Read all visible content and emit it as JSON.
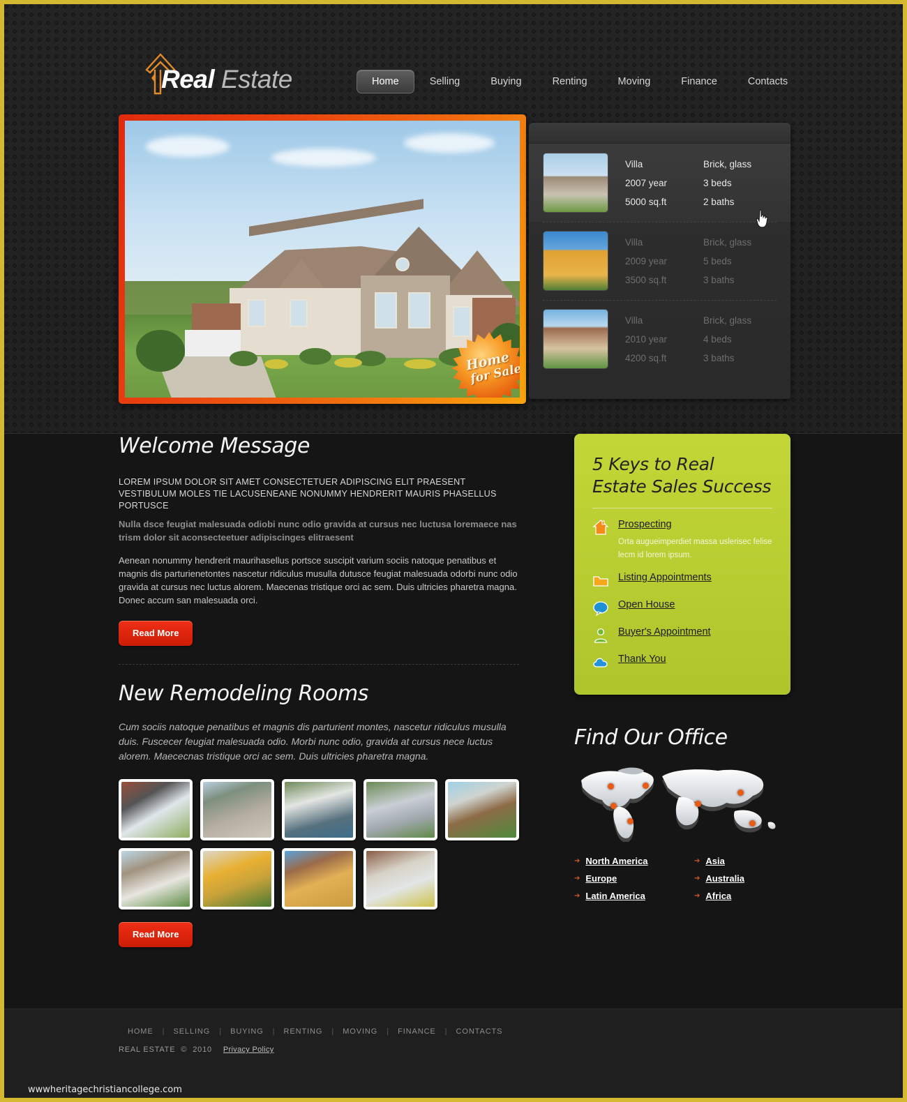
{
  "brand": {
    "logo_word1": "Real",
    "logo_word2": " Estate",
    "logo_icon": "house-arrow-icon",
    "accent_red": "#e02b0d",
    "accent_orange": "#f9a40e",
    "accent_green": "#bccf33",
    "page_border": "#d4b82f"
  },
  "topnav": {
    "items": [
      {
        "label": "Home",
        "active": true
      },
      {
        "label": "Selling",
        "active": false
      },
      {
        "label": "Buying",
        "active": false
      },
      {
        "label": "Renting",
        "active": false
      },
      {
        "label": "Moving",
        "active": false
      },
      {
        "label": "Finance",
        "active": false
      },
      {
        "label": "Contacts",
        "active": false
      }
    ]
  },
  "hero": {
    "badge_line1": "Home",
    "badge_line2": "for Sale",
    "image_alt": "large-suburban-stone-and-brick-house"
  },
  "properties": [
    {
      "type": "Villa",
      "material": "Brick, glass",
      "year": "2007 year",
      "beds": "3 beds",
      "area": "5000 sq.ft",
      "baths": "2 baths",
      "active": true
    },
    {
      "type": "Villa",
      "material": "Brick, glass",
      "year": "2009 year",
      "beds": "5 beds",
      "area": "3500 sq.ft",
      "baths": "3 baths",
      "active": false
    },
    {
      "type": "Villa",
      "material": "Brick, glass",
      "year": "2010 year",
      "beds": "4 beds",
      "area": "4200 sq.ft",
      "baths": "3 baths",
      "active": false
    }
  ],
  "welcome": {
    "title": "Welcome Message",
    "caps": "LOREM IPSUM DOLOR SIT AMET CONSECTETUER ADIPISCING ELIT PRAESENT VESTIBULUM MOLES TIE LACUSENEANE NONUMMY HENDRERIT MAURIS PHASELLUS PORTUSCE",
    "bold": "Nulla dsce feugiat malesuada odiobi nunc odio gravida at cursus nec luctusa loremaece nas trism dolor sit aconsecteetuer adipiscinges elitraesent",
    "para": "Aenean nonummy hendrerit maurihasellus portsce suscipit varium sociis natoque penatibus et magnis dis parturienetontes nascetur ridiculus musulla dutusce feugiat malesuada odorbi nunc odio gravida at cursus nec luctus alorem. Maecenas tristique orci ac sem. Duis ultricies pharetra magna. Donec accum san malesuada orci.",
    "read_more": "Read More"
  },
  "remodeling": {
    "title": "New Remodeling Rooms",
    "para": "Cum sociis natoque penatibus et magnis dis parturient montes, nascetur ridiculus musulla duis. Fuscecer feugiat malesuada odio. Morbi nunc odio, gravida at cursus nece luctus alorem. Maececnas tristique orci ac sem. Duis ultricies pharetra magna.",
    "read_more": "Read More",
    "thumbnails": [
      "brick-house-bay-window",
      "gray-ranch-house-front",
      "white-mansion-with-pool",
      "gray-cottage-arched-window",
      "modern-wood-villa-garden",
      "white-dormer-roof-house",
      "yellow-stucco-house-hedge",
      "yellow-tower-house-blue-shutters",
      "brick-house-with-flowers"
    ]
  },
  "keys": {
    "title": "5 Keys to Real Estate Sales Success",
    "items": [
      {
        "label": "Prospecting",
        "icon": "house-icon",
        "sub": "Orta augueimperdiet massa uslerisec felise lecm id lorem ipsum."
      },
      {
        "label": "Listing Appointments",
        "icon": "folder-icon",
        "sub": ""
      },
      {
        "label": "Open House",
        "icon": "speech-bubble-icon",
        "sub": ""
      },
      {
        "label": "Buyer's Appointment",
        "icon": "user-icon",
        "sub": ""
      },
      {
        "label": "Thank You",
        "icon": "cloud-icon",
        "sub": ""
      }
    ]
  },
  "office": {
    "title": "Find Our Office",
    "map_icon": "world-map",
    "pins": 6,
    "links_col1": [
      "North America",
      "Europe",
      "Latin America"
    ],
    "links_col2": [
      "Asia",
      "Australia",
      "Africa"
    ]
  },
  "footer": {
    "nav": [
      "HOME",
      "SELLING",
      "BUYING",
      "RENTING",
      "MOVING",
      "FINANCE",
      "CONTACTS"
    ],
    "separator": "|",
    "site_name": "REAL ESTATE",
    "copyright_symbol": "©",
    "year": "2010",
    "privacy": "Privacy Policy",
    "watermark": "wwwheritagechristiancollege.com"
  }
}
